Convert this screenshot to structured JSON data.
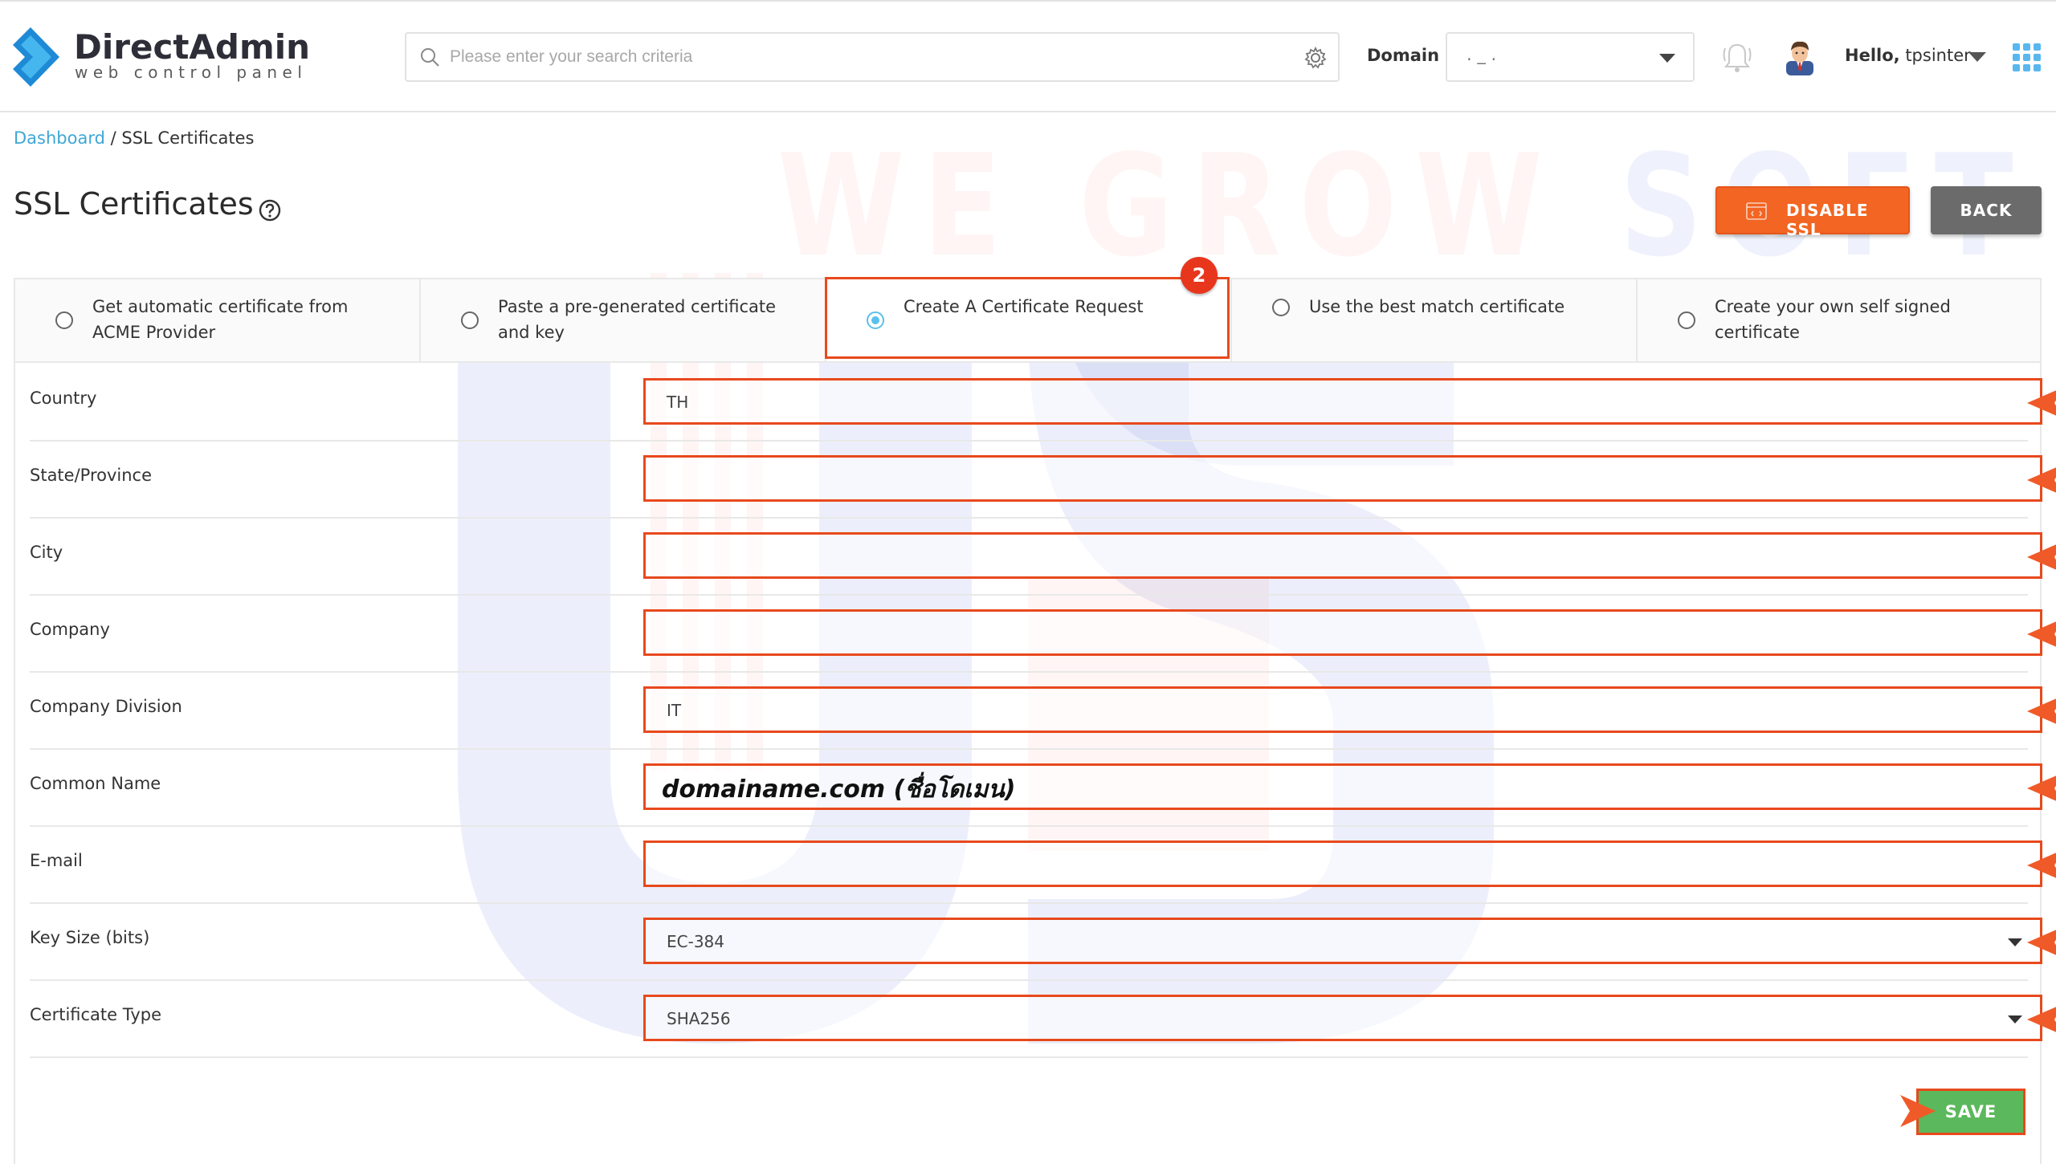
{
  "watermark": {
    "text_part1": "WE GROW",
    "text_part2": "SOFT"
  },
  "brand": {
    "title": "DirectAdmin",
    "subtitle": "web control panel"
  },
  "search": {
    "placeholder": "Please enter your search criteria"
  },
  "domain": {
    "label": "Domain",
    "value": ".     _    ."
  },
  "user": {
    "greeting": "Hello,",
    "name": "tpsinter"
  },
  "breadcrumb": {
    "home": "Dashboard",
    "separator": "/",
    "current": "SSL Certificates"
  },
  "page": {
    "title": "SSL Certificates"
  },
  "actions": {
    "disable_ssl": "DISABLE SSL",
    "back": "BACK",
    "save": "SAVE"
  },
  "tabs": [
    {
      "label": "Get automatic certificate from ACME Provider",
      "checked": false
    },
    {
      "label": "Paste a pre-generated certificate and key",
      "checked": false
    },
    {
      "label": "Create A Certificate Request",
      "checked": true
    },
    {
      "label": "Use the best match certificate",
      "checked": false
    },
    {
      "label": "Create your own self signed certificate",
      "checked": false
    }
  ],
  "step_badge": "2",
  "form": {
    "rows": [
      {
        "label": "Country",
        "value": "TH"
      },
      {
        "label": "State/Province",
        "value": ""
      },
      {
        "label": "City",
        "value": ""
      },
      {
        "label": "Company",
        "value": ""
      },
      {
        "label": "Company Division",
        "value": "IT"
      },
      {
        "label": "Common Name",
        "value": "domainame.com (ชื่อโดเมน)"
      },
      {
        "label": "E-mail",
        "value": ""
      },
      {
        "label": "Key Size (bits)",
        "value": "EC-384"
      },
      {
        "label": "Certificate Type",
        "value": "SHA256"
      }
    ]
  },
  "colors": {
    "accent_orange": "#f26522",
    "annotation_red": "#e8491d",
    "link_blue": "#3fa7d6",
    "radio_blue": "#5bc0eb",
    "save_green": "#5cb85c",
    "back_gray": "#6b6b6b"
  },
  "icons": [
    "search-icon",
    "gear-icon",
    "bell-icon",
    "avatar",
    "apps-grid-icon",
    "help-icon",
    "ssl-icon",
    "chevron-down-icon",
    "annotation-arrow-icon"
  ]
}
